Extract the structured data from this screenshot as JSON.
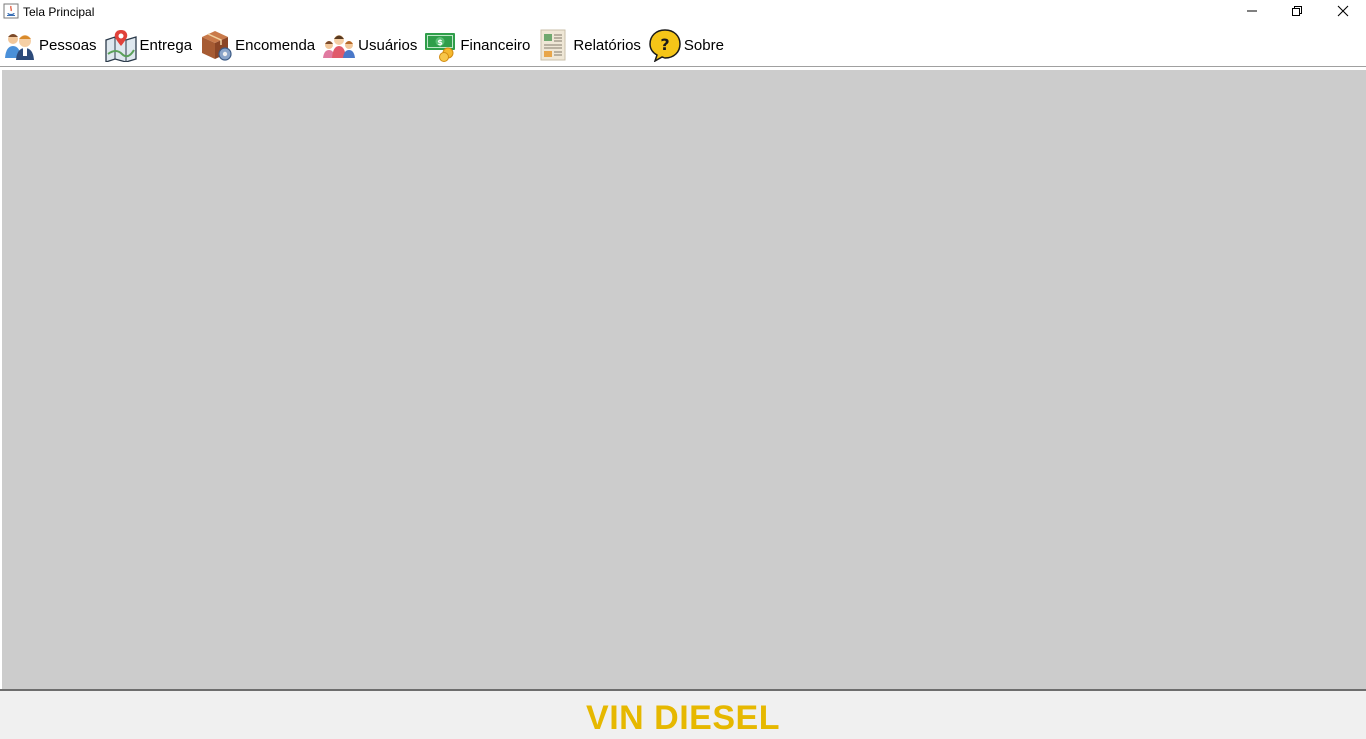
{
  "window": {
    "title": "Tela Principal",
    "controls": {
      "minimize_icon": "minimize-icon",
      "maximize_icon": "restore-icon",
      "close_icon": "close-icon"
    }
  },
  "menu": {
    "items": [
      {
        "label": "Pessoas",
        "icon": "people-icon"
      },
      {
        "label": "Entrega",
        "icon": "map-pin-icon"
      },
      {
        "label": "Encomenda",
        "icon": "package-gear-icon"
      },
      {
        "label": "Usuários",
        "icon": "users-icon"
      },
      {
        "label": "Financeiro",
        "icon": "money-icon"
      },
      {
        "label": "Relatórios",
        "icon": "report-icon"
      },
      {
        "label": "Sobre",
        "icon": "help-bubble-icon"
      }
    ]
  },
  "footer": {
    "brand": "VIN DIESEL",
    "brand_color": "#e6b800"
  },
  "colors": {
    "desktop_background": "#cccccc",
    "footer_background": "#f0f0f0"
  }
}
